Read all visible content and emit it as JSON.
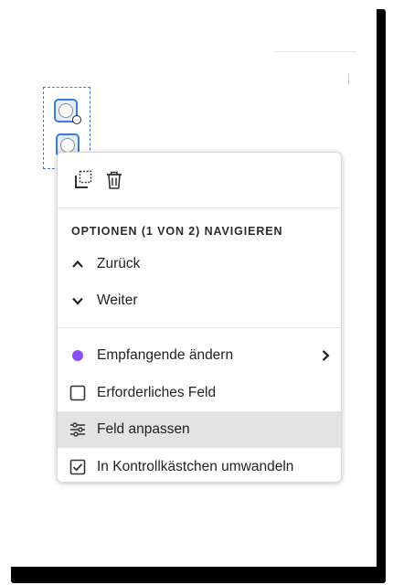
{
  "colors": {
    "selection": "#3b7bd9",
    "recipient_dot": "#8a4ff0",
    "hover_row": "#e3e3e3"
  },
  "form_fields": {
    "type": "radio-group",
    "count": 2
  },
  "menu": {
    "toolbar": {
      "duplicate_icon": "duplicate-field-icon",
      "delete_icon": "trash-icon"
    },
    "section_heading": "OPTIONEN (1 VON 2) NAVIGIEREN",
    "navigation": [
      {
        "label": "Zurück",
        "icon": "chevron-up-icon"
      },
      {
        "label": "Weiter",
        "icon": "chevron-down-icon"
      }
    ],
    "actions": [
      {
        "label": "Empfangende ändern",
        "icon": "purple-dot",
        "has_submenu": true
      },
      {
        "label": "Erforderliches Feld",
        "icon": "checkbox-unchecked-icon",
        "checked": false
      },
      {
        "label": "Feld anpassen",
        "icon": "sliders-icon",
        "highlighted": true
      },
      {
        "label": "In Kontrollkästchen umwandeln",
        "icon": "checkbox-checked-icon"
      }
    ]
  }
}
